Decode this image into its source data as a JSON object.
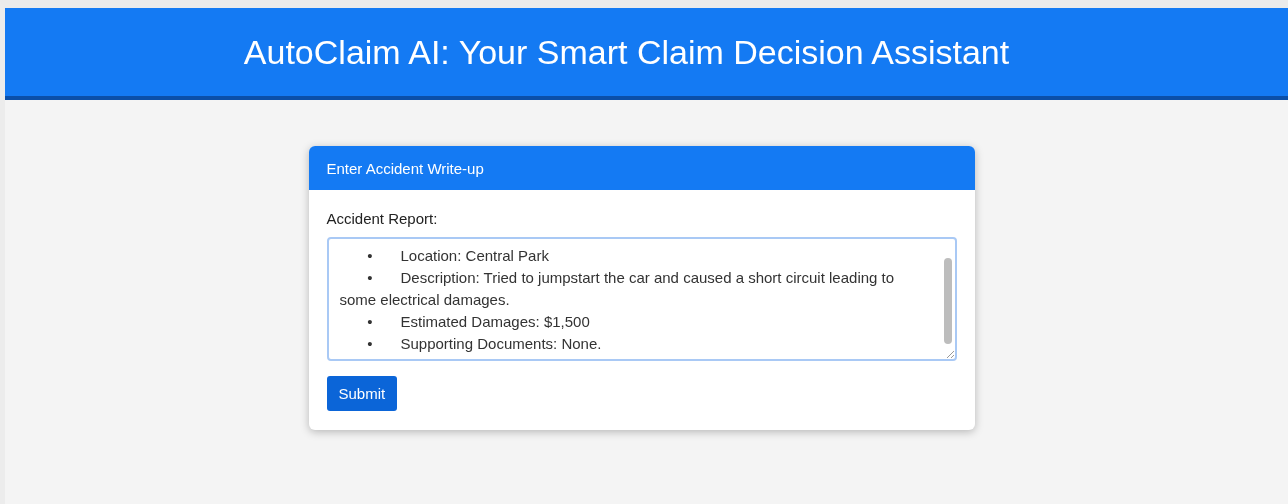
{
  "header": {
    "title": "AutoClaim AI: Your Smart Claim Decision Assistant"
  },
  "card": {
    "title": "Enter Accident Write-up",
    "field_label": "Accident Report:",
    "report_lines": [
      {
        "kind": "bullet",
        "bullet": "•",
        "text": "Location: Central Park"
      },
      {
        "kind": "bullet",
        "bullet": "•",
        "text": "Description: Tried to jumpstart the car and caused a short circuit leading to"
      },
      {
        "kind": "continuation",
        "text": "some electrical damages."
      },
      {
        "kind": "bullet",
        "bullet": "•",
        "text": "Estimated Damages: $1,500"
      },
      {
        "kind": "bullet",
        "bullet": "•",
        "text": "Supporting Documents: None."
      }
    ],
    "submit": "Submit"
  }
}
